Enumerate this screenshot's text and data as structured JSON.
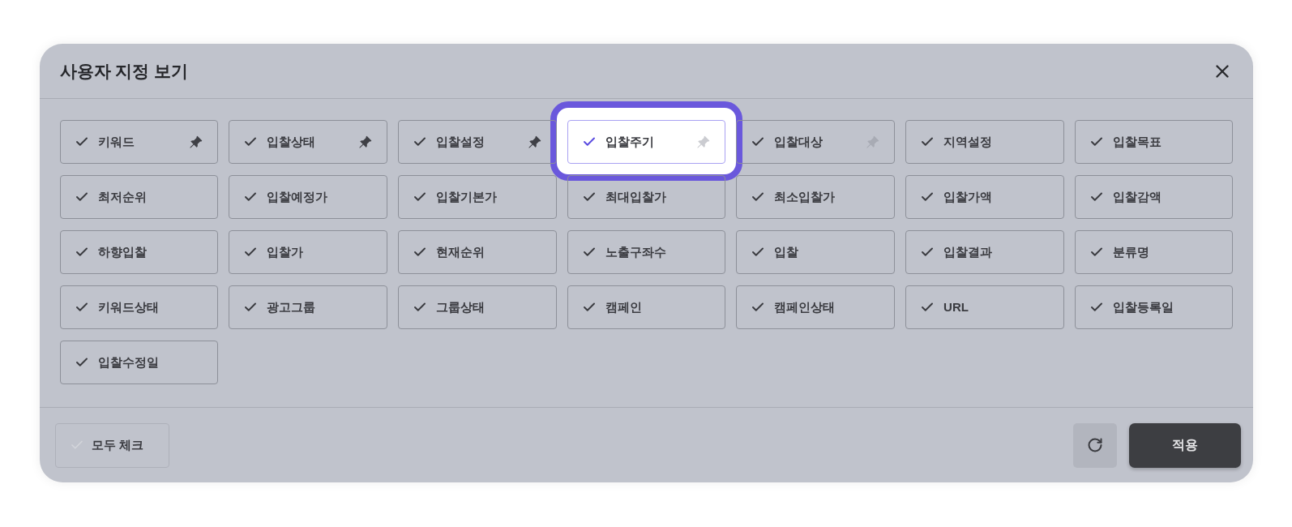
{
  "dialog": {
    "title": "사용자 지정 보기"
  },
  "items": [
    {
      "label": "키워드",
      "checked": true,
      "pinned": true,
      "highlighted": false
    },
    {
      "label": "입찰상태",
      "checked": true,
      "pinned": true,
      "highlighted": false
    },
    {
      "label": "입찰설정",
      "checked": true,
      "pinned": true,
      "highlighted": false
    },
    {
      "label": "입찰주기",
      "checked": true,
      "pinned": false,
      "highlighted": true
    },
    {
      "label": "입찰대상",
      "checked": true,
      "pinned": false,
      "highlighted": false
    },
    {
      "label": "지역설정",
      "checked": true,
      "highlighted": false
    },
    {
      "label": "입찰목표",
      "checked": true,
      "highlighted": false
    },
    {
      "label": "최저순위",
      "checked": true,
      "highlighted": false
    },
    {
      "label": "입찰예정가",
      "checked": true,
      "highlighted": false
    },
    {
      "label": "입찰기본가",
      "checked": true,
      "highlighted": false
    },
    {
      "label": "최대입찰가",
      "checked": true,
      "highlighted": false
    },
    {
      "label": "최소입찰가",
      "checked": true,
      "highlighted": false
    },
    {
      "label": "입찰가액",
      "checked": true,
      "highlighted": false
    },
    {
      "label": "입찰감액",
      "checked": true,
      "highlighted": false
    },
    {
      "label": "하향입찰",
      "checked": true,
      "highlighted": false
    },
    {
      "label": "입찰가",
      "checked": true,
      "highlighted": false
    },
    {
      "label": "현재순위",
      "checked": true,
      "highlighted": false
    },
    {
      "label": "노출구좌수",
      "checked": true,
      "highlighted": false
    },
    {
      "label": "입찰",
      "checked": true,
      "highlighted": false
    },
    {
      "label": "입찰결과",
      "checked": true,
      "highlighted": false
    },
    {
      "label": "분류명",
      "checked": true,
      "highlighted": false
    },
    {
      "label": "키워드상태",
      "checked": true,
      "highlighted": false
    },
    {
      "label": "광고그룹",
      "checked": true,
      "highlighted": false
    },
    {
      "label": "그룹상태",
      "checked": true,
      "highlighted": false
    },
    {
      "label": "캠페인",
      "checked": true,
      "highlighted": false
    },
    {
      "label": "캠페인상태",
      "checked": true,
      "highlighted": false
    },
    {
      "label": "URL",
      "checked": true,
      "highlighted": false
    },
    {
      "label": "입찰등록일",
      "checked": true,
      "highlighted": false
    },
    {
      "label": "입찰수정일",
      "checked": true,
      "highlighted": false
    }
  ],
  "footer": {
    "check_all": {
      "label": "모두 체크",
      "checked": false
    },
    "apply": {
      "label": "적용"
    }
  }
}
